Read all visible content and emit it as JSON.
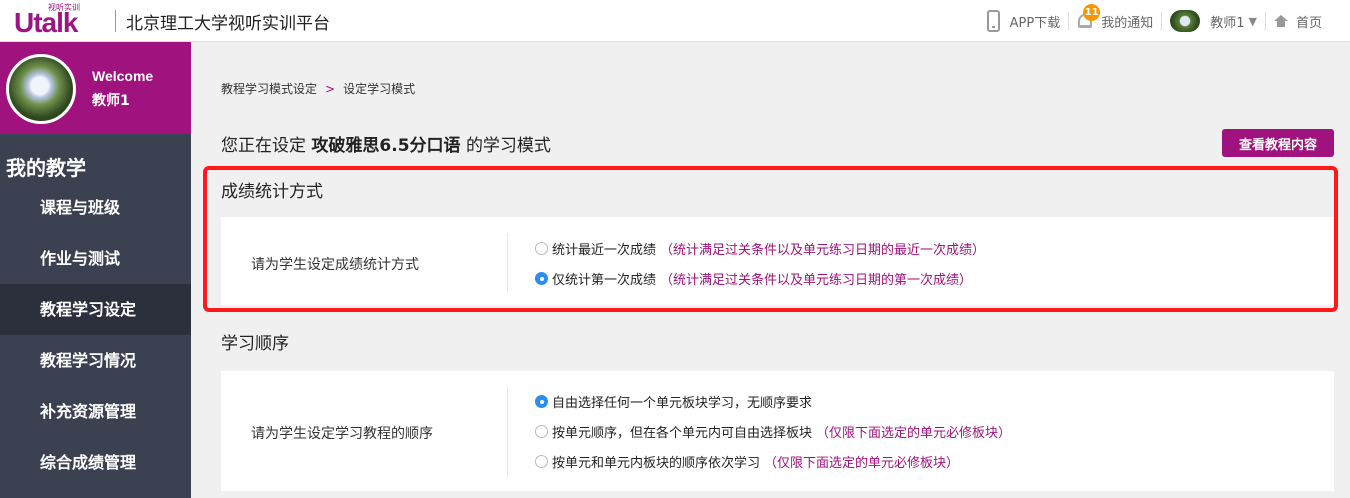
{
  "header": {
    "logo_small": "视听实训",
    "logo_main": "Utalk",
    "platform_title": "北京理工大学视听实训平台",
    "app_download": "APP下载",
    "notification_count": "11",
    "notifications": "我的通知",
    "user": "教师1",
    "home": "首页"
  },
  "sidebar": {
    "welcome": "Welcome",
    "user_name": "教师1",
    "menu_title": "我的教学",
    "items": [
      {
        "label": "课程与班级",
        "active": false
      },
      {
        "label": "作业与测试",
        "active": false
      },
      {
        "label": "教程学习设定",
        "active": true
      },
      {
        "label": "教程学习情况",
        "active": false
      },
      {
        "label": "补充资源管理",
        "active": false
      },
      {
        "label": "综合成绩管理",
        "active": false
      }
    ]
  },
  "main": {
    "breadcrumb": [
      "教程学习模式设定",
      ">",
      "设定学习模式"
    ],
    "heading_prefix": "您正在设定",
    "heading_course": "攻破雅思6.5分口语",
    "heading_suffix": "的学习模式",
    "view_button": "查看教程内容",
    "score_section": {
      "title": "成绩统计方式",
      "label": "请为学生设定成绩统计方式",
      "options": [
        {
          "text": "统计最近一次成绩",
          "note": "（统计满足过关条件以及单元练习日期的最近一次成绩）",
          "checked": false
        },
        {
          "text": "仅统计第一次成绩",
          "note": "（统计满足过关条件以及单元练习日期的第一次成绩）",
          "checked": true
        }
      ]
    },
    "order_section": {
      "title": "学习顺序",
      "label": "请为学生设定学习教程的顺序",
      "options": [
        {
          "text": "自由选择任何一个单元板块学习，无顺序要求",
          "note": "",
          "checked": true
        },
        {
          "text": "按单元顺序，但在各个单元内可自由选择板块",
          "note": "（仅限下面选定的单元必修板块）",
          "checked": false
        },
        {
          "text": "按单元和单元内板块的顺序依次学习",
          "note": "（仅限下面选定的单元必修板块）",
          "checked": false
        }
      ]
    }
  },
  "colors": {
    "brand": "#a0127d",
    "sidebar_bg": "#3b4150",
    "radio_checked": "#2d8cf0",
    "highlight": "#ff1a1a",
    "badge": "#f39800"
  }
}
